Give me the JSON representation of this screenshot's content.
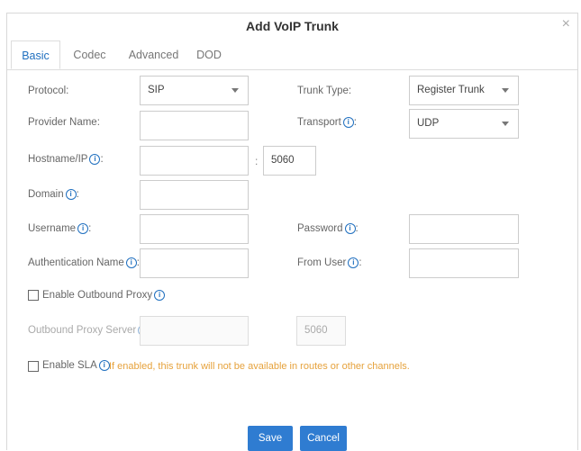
{
  "dialog": {
    "title": "Add VoIP Trunk",
    "close_glyph": "×"
  },
  "tabs": [
    {
      "label": "Basic",
      "active": true
    },
    {
      "label": "Codec",
      "active": false
    },
    {
      "label": "Advanced",
      "active": false
    },
    {
      "label": "DOD",
      "active": false
    }
  ],
  "form": {
    "protocol": {
      "label": "Protocol:",
      "value": "SIP"
    },
    "trunk_type": {
      "label": "Trunk Type:",
      "value": "Register Trunk"
    },
    "provider_name": {
      "label": "Provider Name:",
      "value": ""
    },
    "transport": {
      "label": "Transport",
      "value": "UDP"
    },
    "hostname": {
      "label": "Hostname/IP",
      "value": "",
      "port": "5060",
      "separator": ":"
    },
    "domain": {
      "label": "Domain",
      "value": ""
    },
    "username": {
      "label": "Username",
      "value": ""
    },
    "password": {
      "label": "Password",
      "value": ""
    },
    "auth_name": {
      "label": "Authentication Name",
      "value": ""
    },
    "from_user": {
      "label": "From User",
      "value": ""
    },
    "outbound_proxy": {
      "label": "Enable Outbound Proxy",
      "checked": false
    },
    "outbound_proxy_server": {
      "label": "Outbound Proxy Server",
      "value": "",
      "port": "5060"
    },
    "sla": {
      "label": "Enable SLA",
      "checked": false,
      "note": "If enabled, this trunk will not be available in routes or other channels."
    }
  },
  "buttons": {
    "save": "Save",
    "cancel": "Cancel"
  },
  "colors": {
    "accent": "#2f7cd1",
    "warning": "#e6a23c"
  }
}
